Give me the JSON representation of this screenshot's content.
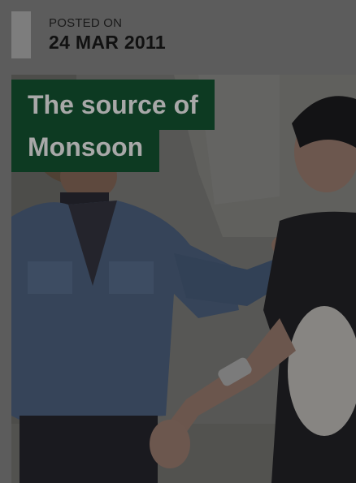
{
  "post": {
    "posted_label": "POSTED ON",
    "date": "24 MAR 2011",
    "title_line1": "The source of",
    "title_line2": "Monsoon"
  },
  "colors": {
    "page_background": "#5c5c5c",
    "meta_bar": "#7d7d7d",
    "title_background": "#0d3a22",
    "title_text": "#a8a8a8"
  }
}
